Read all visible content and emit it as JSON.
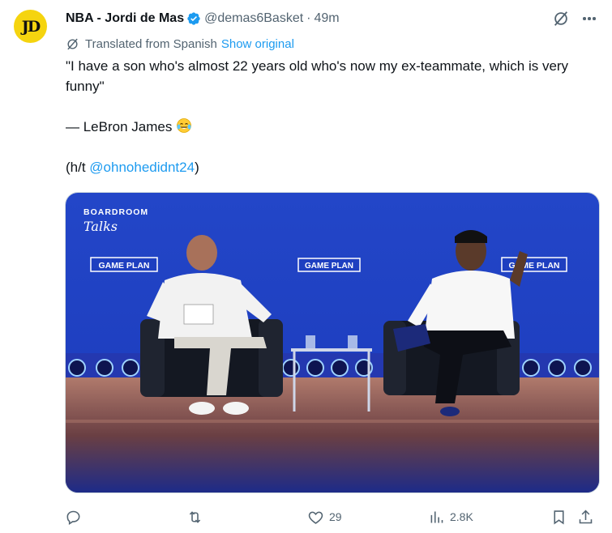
{
  "post": {
    "author_name": "NBA - Jordi de Mas",
    "handle": "@demas6Basket",
    "separator": "·",
    "time": "49m",
    "avatar_text": "JD",
    "avatar_color": "#f5d40f",
    "verified_color": "#1d9bf0"
  },
  "translation": {
    "label": "Translated from Spanish",
    "action": "Show original"
  },
  "content": {
    "quote_line": "\"I have a son who's almost 22 years old who's now my ex-teammate, which is very funny\"",
    "attribution": "— LeBron James",
    "attribution_emoji": "face-with-tears-of-joy",
    "credit_prefix": "(h/t ",
    "credit_mention": "@ohnohedidnt24",
    "credit_suffix": ")"
  },
  "media": {
    "brand_top": "BOARDROOM",
    "brand_bottom": "Talks",
    "sign_left": "GAME PLAN",
    "sign_center": "GAME PLAN",
    "sign_right": "GAME PLAN",
    "card_text": "GAME PLAN",
    "backdrop_color": "#1e3fc0"
  },
  "actions": {
    "replies": "",
    "reposts": "",
    "likes": "29",
    "views": "2.8K",
    "icons": [
      "reply-icon",
      "repost-icon",
      "like-icon",
      "views-icon",
      "bookmark-icon",
      "share-icon"
    ]
  }
}
